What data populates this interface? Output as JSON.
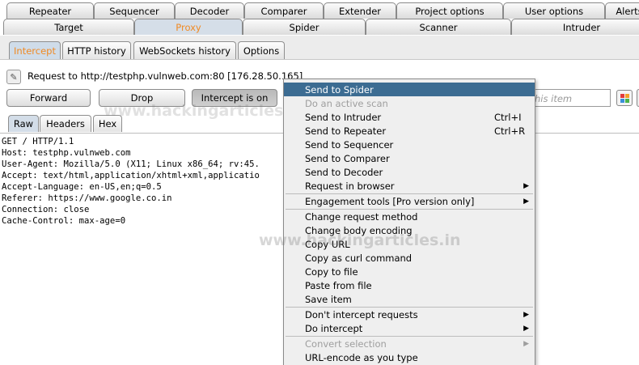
{
  "top_tabs_row1": [
    "Repeater",
    "Sequencer",
    "Decoder",
    "Comparer",
    "Extender",
    "Project options",
    "User options",
    "Alerts"
  ],
  "top_tabs_row2": [
    "Target",
    "Proxy",
    "Spider",
    "Scanner",
    "Intruder"
  ],
  "proxy_tabs": [
    "Intercept",
    "HTTP history",
    "WebSockets history",
    "Options"
  ],
  "request_line": "Request to http://testphp.vulnweb.com:80  [176.28.50.165]",
  "buttons": {
    "forward": "Forward",
    "drop": "Drop",
    "intercept": "Intercept is on"
  },
  "search_placeholder": "his item",
  "editor_tabs": [
    "Raw",
    "Headers",
    "Hex"
  ],
  "request_lines": [
    "GET / HTTP/1.1",
    "Host: testphp.vulnweb.com",
    "User-Agent: Mozilla/5.0 (X11; Linux x86_64; rv:45.",
    "Accept: text/html,application/xhtml+xml,applicatio",
    "Accept-Language: en-US,en;q=0.5",
    "Referer: https://www.google.co.in",
    "Connection: close",
    "Cache-Control: max-age=0"
  ],
  "watermark": "www.hackingarticles.in",
  "context_menu": [
    {
      "label": "Send to Spider",
      "state": "highlighted"
    },
    {
      "label": "Do an active scan",
      "state": "disabled"
    },
    {
      "label": "Send to Intruder",
      "shortcut": "Ctrl+I"
    },
    {
      "label": "Send to Repeater",
      "shortcut": "Ctrl+R"
    },
    {
      "label": "Send to Sequencer"
    },
    {
      "label": "Send to Comparer"
    },
    {
      "label": "Send to Decoder"
    },
    {
      "label": "Request in browser",
      "submenu": true
    },
    {
      "label": "Engagement tools [Pro version only]",
      "submenu": true
    },
    {
      "label": "Change request method"
    },
    {
      "label": "Change body encoding"
    },
    {
      "label": "Copy URL"
    },
    {
      "label": "Copy as curl command"
    },
    {
      "label": "Copy to file"
    },
    {
      "label": "Paste from file"
    },
    {
      "label": "Save item"
    },
    {
      "label": "Don't intercept requests",
      "submenu": true
    },
    {
      "label": "Do intercept",
      "submenu": true
    },
    {
      "label": "Convert selection",
      "state": "disabled",
      "submenu": true
    },
    {
      "label": "URL-encode as you type"
    }
  ],
  "colors": {
    "accent": "#f08a24",
    "highlight": "#3c6c92"
  }
}
